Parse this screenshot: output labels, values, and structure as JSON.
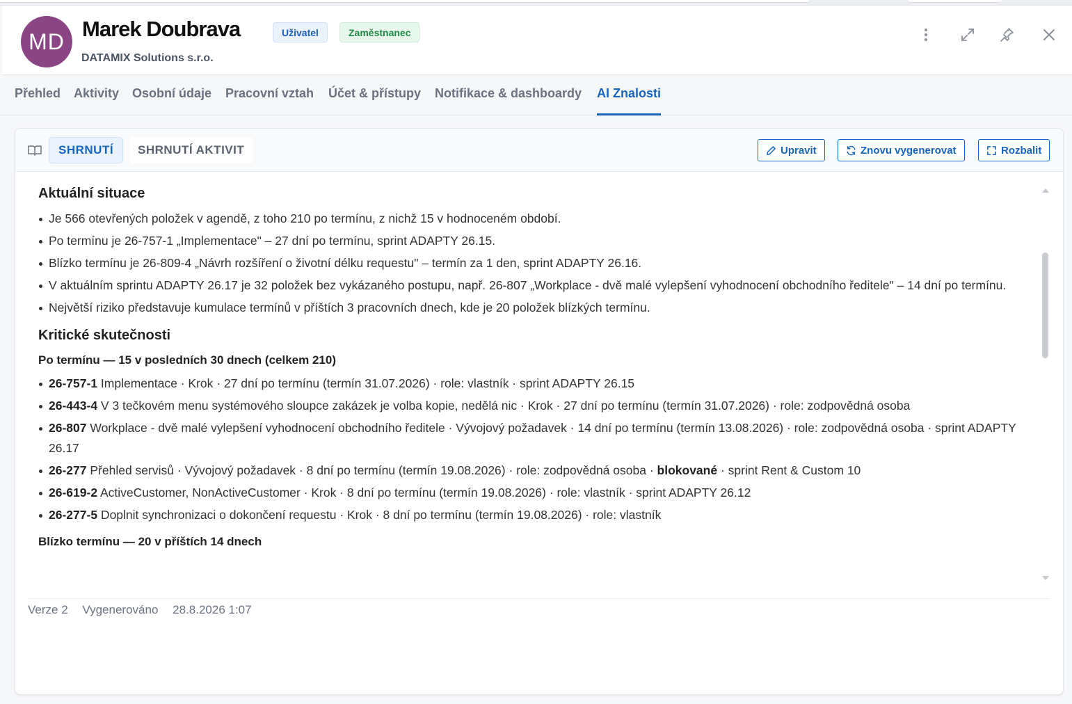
{
  "header": {
    "avatar_initials": "MD",
    "name": "Marek Doubrava",
    "company": "DATAMIX Solutions s.r.o.",
    "badges": [
      "Uživatel",
      "Zaměstnanec"
    ],
    "icons": [
      "more-vertical-icon",
      "expand-icon",
      "pin-icon",
      "close-icon"
    ]
  },
  "tabs": [
    {
      "label": "Přehled"
    },
    {
      "label": "Aktivity"
    },
    {
      "label": "Osobní údaje"
    },
    {
      "label": "Pracovní vztah"
    },
    {
      "label": "Účet & přístupy"
    },
    {
      "label": "Notifikace & dashboardy"
    },
    {
      "label": "AI Znalosti",
      "active": true
    }
  ],
  "toolbar": {
    "subtabs": [
      "SHRNUTÍ",
      "SHRNUTÍ AKTIVIT"
    ],
    "active_subtab": "SHRNUTÍ",
    "buttons": [
      "Upravit",
      "Znovu vygenerovat",
      "Rozbalit"
    ]
  },
  "content": {
    "section1": {
      "title": "Aktuální situace",
      "items": [
        "Je 566 otevřených položek v agendě, z toho 210 po termínu, z nichž 15 v hodnoceném období.",
        "Po termínu je 26-757-1 „Implementace\" – 27 dní po termínu, sprint ADAPTY 26.15.",
        "Blízko termínu je 26-809-4 „Návrh rozšíření o životní délku requestu\" – termín za 1 den, sprint ADAPTY 26.16.",
        "V aktuálním sprintu ADAPTY 26.17 je 32 položek bez vykázaného postupu, např. 26-807 „Workplace - dvě malé vylepšení vyhodnocení obchodního ředitele\" – 14 dní po termínu.",
        "Největší riziko představuje kumulace termínů v příštích 3 pracovních dnech, kde je 20 položek blízkých termínu."
      ]
    },
    "section2": {
      "title": "Kritické skutečnosti",
      "subtitle": "Po termínu — 15 v posledních 30 dnech (celkem 210)",
      "items": [
        {
          "id": "26-757-1",
          "text": " Implementace · Krok · 27 dní po termínu (termín 31.07.2026) · role: vlastník · sprint ADAPTY 26.15"
        },
        {
          "id": "26-443-4",
          "text": " V 3 tečkovém menu systémového sloupce zakázek je volba kopie, nedělá nic · Krok · 27 dní po termínu (termín 31.07.2026) · role: zodpovědná osoba"
        },
        {
          "id": "26-807",
          "text": " Workplace - dvě malé vylepšení vyhodnocení obchodního ředitele · Vývojový požadavek · 14 dní po termínu (termín 13.08.2026) · role: zodpovědná osoba · sprint ADAPTY 26.17"
        },
        {
          "id": "26-277",
          "text": " Přehled servisů · Vývojový požadavek · 8 dní po termínu (termín 19.08.2026) · role: zodpovědná osoba · ",
          "bold_mid": "blokované",
          "text_after": " · sprint Rent & Custom 10"
        },
        {
          "id": "26-619-2",
          "text": " ActiveCustomer, NonActiveCustomer · Krok · 8 dní po termínu (termín 19.08.2026) · role: vlastník · sprint ADAPTY 26.12"
        },
        {
          "id": "26-277-5",
          "text": " Doplnit synchronizaci o dokončení requestu · Krok · 8 dní po termínu (termín 19.08.2026) · role: vlastník"
        }
      ]
    },
    "section3": {
      "subtitle": "Blízko termínu — 20 v příštích 14 dnech"
    }
  },
  "footer": {
    "version": "Verze 2",
    "generated_label": "Vygenerováno",
    "generated_at": "28.8.2026 1:07"
  },
  "colors": {
    "accent": "#1565c0",
    "avatar": "#8a4585",
    "badge_user": "#1b5fbf",
    "badge_employee": "#1e8a43"
  }
}
